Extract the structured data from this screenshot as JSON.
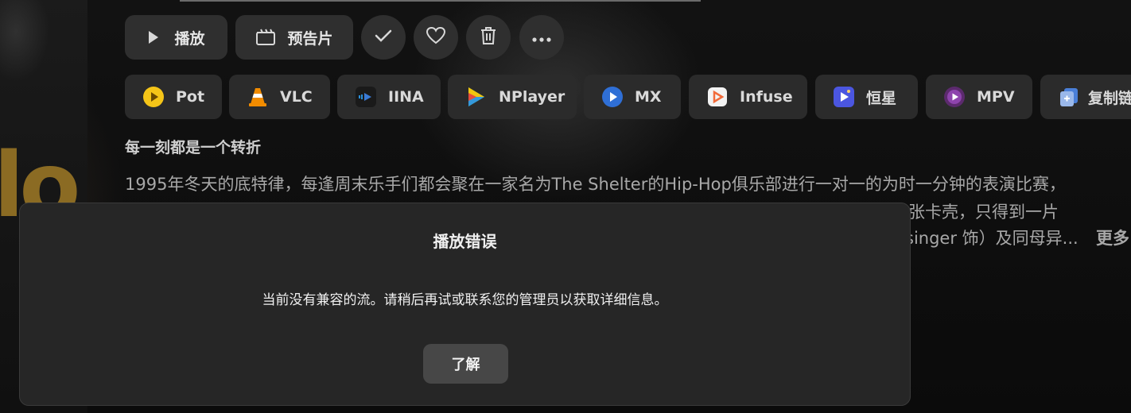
{
  "actions": {
    "play_label": "播放",
    "trailer_label": "预告片",
    "icons": [
      "play-icon",
      "film-icon",
      "check-icon",
      "heart-icon",
      "trash-icon",
      "more-icon"
    ]
  },
  "players": [
    {
      "label": "Pot",
      "icon": "pot-player-icon",
      "color": "#f5c518"
    },
    {
      "label": "VLC",
      "icon": "vlc-cone-icon",
      "color": "#f28c00"
    },
    {
      "label": "IINA",
      "icon": "iina-icon",
      "color": "#3a7bd5"
    },
    {
      "label": "NPlayer",
      "icon": "nplayer-icon",
      "color": "#2ecc71"
    },
    {
      "label": "MX",
      "icon": "mx-player-icon",
      "color": "#2f6fd6"
    },
    {
      "label": "Infuse",
      "icon": "infuse-icon",
      "color": "#f26b3a"
    },
    {
      "label": "恒星",
      "icon": "stellar-icon",
      "color": "#5b5be0"
    },
    {
      "label": "MPV",
      "icon": "mpv-icon",
      "color": "#8e44ad"
    },
    {
      "label": "复制链",
      "icon": "copy-link-icon",
      "color": "#4a7fd8"
    }
  ],
  "tagline": "每一刻都是一个转折",
  "overview": {
    "line1": "1995年冬天的底特律，每逢周末乐手们都会聚在一家名为The Shelter的Hip-Hop俱乐部进行一对一的为时一分钟的表演比赛，",
    "line2_visible": "紧张卡壳，只得到一片",
    "line3_visible": "singer 饰）及同母异...",
    "more_label": "更多"
  },
  "dialog": {
    "title": "播放错误",
    "message": "当前没有兼容的流。请稍后再试或联系您的管理员以获取详细信息。",
    "ok_label": "了解"
  }
}
